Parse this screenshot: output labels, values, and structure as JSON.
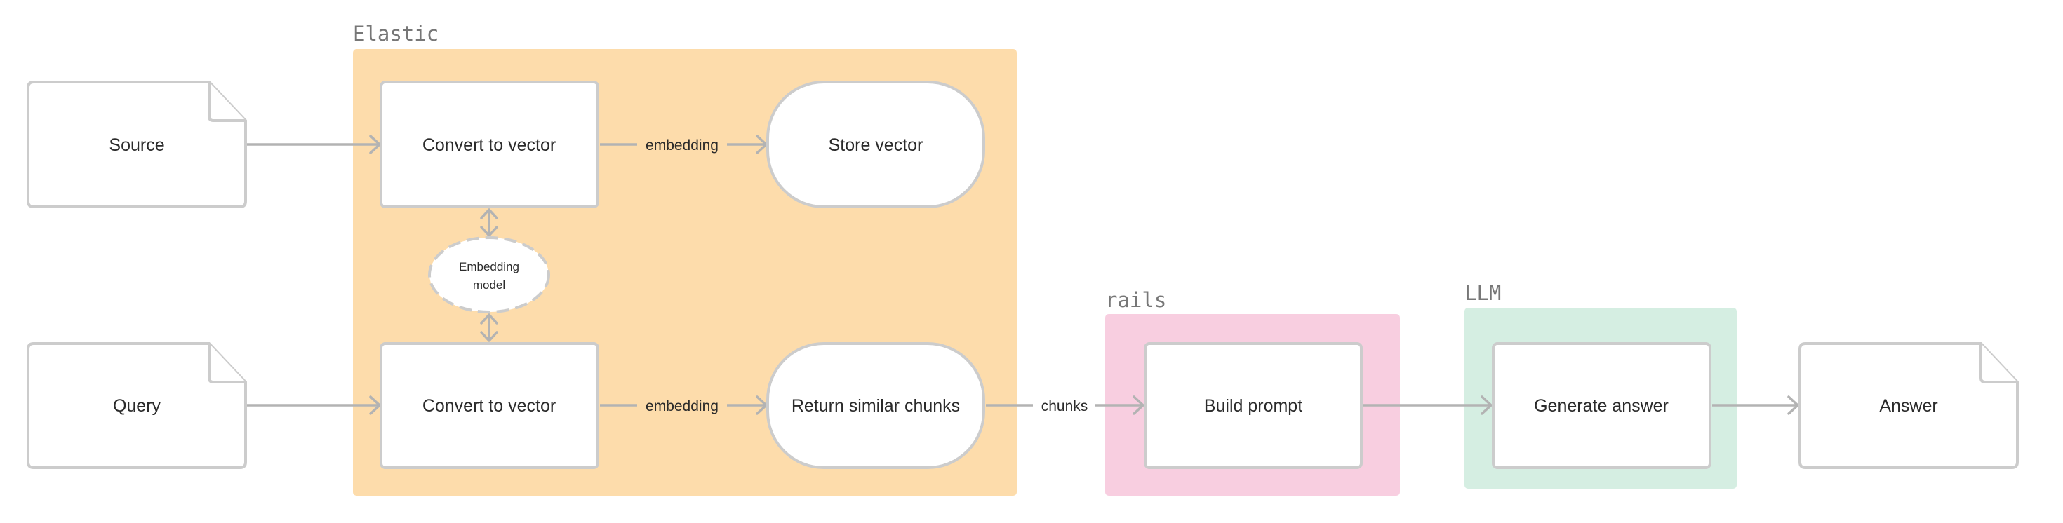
{
  "groups": {
    "elastic": {
      "label": "Elastic",
      "color": "#FDDCAB"
    },
    "rails": {
      "label": "rails",
      "color": "#F8CEE0"
    },
    "llm": {
      "label": "LLM",
      "color": "#D5EEE2"
    }
  },
  "nodes": {
    "source": {
      "label": "Source",
      "shape": "document"
    },
    "query": {
      "label": "Query",
      "shape": "document"
    },
    "convert_top": {
      "label": "Convert to vector",
      "shape": "rectangle"
    },
    "convert_bottom": {
      "label": "Convert to vector",
      "shape": "rectangle"
    },
    "store_vector": {
      "label": "Store vector",
      "shape": "rounded"
    },
    "return_chunks": {
      "label": "Return similar chunks",
      "shape": "rounded"
    },
    "embedding_model": {
      "label_line1": "Embedding",
      "label_line2": "model",
      "shape": "dashed-ellipse"
    },
    "build_prompt": {
      "label": "Build prompt",
      "shape": "rectangle"
    },
    "generate_answer": {
      "label": "Generate answer",
      "shape": "rectangle"
    },
    "answer": {
      "label": "Answer",
      "shape": "document"
    }
  },
  "edges": {
    "source_to_convert": {
      "label": ""
    },
    "convert_to_store": {
      "label": "embedding"
    },
    "query_to_convert": {
      "label": ""
    },
    "convert_to_return": {
      "label": "embedding"
    },
    "return_to_build": {
      "label": "chunks"
    },
    "build_to_generate": {
      "label": ""
    },
    "generate_to_answer": {
      "label": ""
    },
    "model_top_link": {
      "label": ""
    },
    "model_bottom_link": {
      "label": ""
    }
  },
  "colors": {
    "node_border": "#cccccc",
    "edge": "#b3b3b3",
    "text": "#2b2b2b",
    "group_label": "#777777"
  }
}
